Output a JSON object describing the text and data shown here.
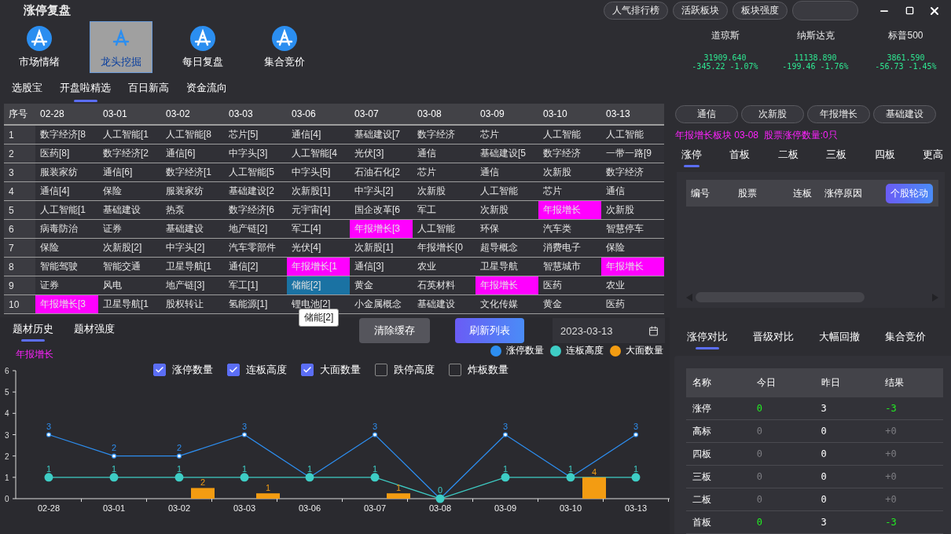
{
  "title": "涨停复盘",
  "top_buttons": [
    "人气排行榜",
    "活跃板块",
    "板块强度"
  ],
  "nav": [
    {
      "label": "市场情绪",
      "selected": false
    },
    {
      "label": "龙头挖掘",
      "selected": true
    },
    {
      "label": "每日复盘",
      "selected": false
    },
    {
      "label": "集合竞价",
      "selected": false
    }
  ],
  "indices": [
    {
      "name": "道琼斯",
      "value": "31909.640",
      "change": "-345.22",
      "percent": "-1.07%"
    },
    {
      "name": "纳斯达克",
      "value": "11138.890",
      "change": "-199.46",
      "percent": "-1.76%"
    },
    {
      "name": "标普500",
      "value": "3861.590",
      "change": "-56.73",
      "percent": "-1.45%"
    }
  ],
  "sub_tabs": [
    {
      "label": "选股宝",
      "selected": false
    },
    {
      "label": "开盘啦精选",
      "selected": true
    },
    {
      "label": "百日新高",
      "selected": false
    },
    {
      "label": "资金流向",
      "selected": false
    }
  ],
  "table": {
    "columns": [
      "序号",
      "02-28",
      "03-01",
      "03-02",
      "03-03",
      "03-06",
      "03-07",
      "03-08",
      "03-09",
      "03-10",
      "03-13"
    ],
    "rows": [
      {
        "cells": [
          "1",
          "数字经济[8",
          "人工智能[1",
          "人工智能[8",
          "芯片[5]",
          "通信[4]",
          "基础建设[7",
          "数字经济",
          "芯片",
          "人工智能",
          "人工智能"
        ]
      },
      {
        "cells": [
          "2",
          "医药[8]",
          "数字经济[2",
          "通信[6]",
          "中字头[3]",
          "人工智能[4",
          "光伏[3]",
          "通信",
          "基础建设[5",
          "数字经济",
          "一带一路[9"
        ]
      },
      {
        "cells": [
          "3",
          "服装家纺",
          "通信[6]",
          "数字经济[1",
          "人工智能[5",
          "中字头[5]",
          "石油石化[2",
          "芯片",
          "通信",
          "次新股",
          "数字经济"
        ]
      },
      {
        "cells": [
          "4",
          "通信[4]",
          "保险",
          "服装家纺",
          "基础建设[2",
          "次新股[1]",
          "中字头[2]",
          "次新股",
          "人工智能",
          "芯片",
          "通信"
        ]
      },
      {
        "cells": [
          "5",
          "人工智能[1",
          "基础建设",
          "热泵",
          "数字经济[6",
          "元宇宙[4]",
          "国企改革[6",
          "军工",
          "次新股",
          {
            "text": "年报增长",
            "color": "#ff00ff"
          },
          "次新股"
        ]
      },
      {
        "cells": [
          "6",
          "病毒防治",
          "证券",
          "基础建设",
          "地产链[2]",
          "军工[4]",
          {
            "text": "年报增长[3",
            "color": "#ff00ff"
          },
          "人工智能",
          "环保",
          "汽车类",
          "智慧停车"
        ]
      },
      {
        "cells": [
          "7",
          "保险",
          "次新股[2]",
          "中字头[2]",
          "汽车零部件",
          "光伏[4]",
          "次新股[1]",
          "年报增长[0",
          "超导概念",
          "消费电子",
          "保险"
        ]
      },
      {
        "cells": [
          "8",
          "智能驾驶",
          "智能交通",
          "卫星导航[1",
          "通信[2]",
          {
            "text": "年报增长[1",
            "color": "#ff00ff"
          },
          "通信[3]",
          "农业",
          "卫星导航",
          "智慧城市",
          {
            "text": "年报增长",
            "color": "#ff00ff"
          }
        ]
      },
      {
        "cells": [
          "9",
          "证券",
          "风电",
          "地产链[3]",
          "军工[1]",
          {
            "text": "储能[2]",
            "color": "#1a72a3"
          },
          "黄金",
          "石英材料",
          {
            "text": "年报增长",
            "color": "#ff00ff"
          },
          "医药",
          "农业"
        ]
      },
      {
        "cells": [
          "10",
          {
            "text": "年报增长[3",
            "color": "#ff00ff"
          },
          "卫星导航[1",
          "股权转让",
          "氢能源[1]",
          "锂电池[2]",
          "小金属概念",
          "基础建设",
          "文化传媒",
          "黄金",
          "医药"
        ]
      }
    ]
  },
  "tooltip": "储能[2]",
  "sector_buttons": [
    "通信",
    "次新股",
    "年报增长",
    "基础建设"
  ],
  "sector_info": "年报增长板块 03-08  股票涨停数量:0只",
  "board_tabs": [
    {
      "label": "涨停",
      "selected": true
    },
    {
      "label": "首板",
      "selected": false
    },
    {
      "label": "二板",
      "selected": false
    },
    {
      "label": "三板",
      "selected": false
    },
    {
      "label": "四板",
      "selected": false
    },
    {
      "label": "更高",
      "selected": false
    }
  ],
  "stock_table": {
    "columns": [
      "编号",
      "股票",
      "连板",
      "涨停原因"
    ],
    "action": "个股轮动"
  },
  "history_tabs": [
    {
      "label": "题材历史",
      "selected": true
    },
    {
      "label": "题材强度",
      "selected": false
    }
  ],
  "clear_button": "清除缓存",
  "refresh_button": "刷新列表",
  "date": "2023-03-13",
  "chart_label": "年报增长",
  "toggles": [
    {
      "label": "涨停数量",
      "checked": true
    },
    {
      "label": "连板高度",
      "checked": true
    },
    {
      "label": "大面数量",
      "checked": true
    },
    {
      "label": "跌停高度",
      "checked": false
    },
    {
      "label": "炸板数量",
      "checked": false
    }
  ],
  "chart_data": {
    "type": "line",
    "categories": [
      "02-28",
      "03-01",
      "03-02",
      "03-03",
      "03-06",
      "03-07",
      "03-08",
      "03-09",
      "03-10",
      "03-13"
    ],
    "ylim": [
      0,
      6
    ],
    "yticks": [
      0,
      1,
      2,
      3,
      4,
      5,
      6
    ],
    "annotations": [
      "2",
      "1",
      "1",
      "4"
    ],
    "series": [
      {
        "name": "涨停数量",
        "type": "line",
        "marker": "dot",
        "color": "#2d8ef0",
        "values": [
          3,
          2,
          2,
          3,
          1,
          3,
          0,
          3,
          1,
          3
        ],
        "value_labels": [
          "3",
          "2",
          "2",
          "3",
          null,
          "3",
          null,
          "3",
          null,
          "3"
        ]
      },
      {
        "name": "连板高度",
        "type": "line",
        "marker": "circle",
        "color": "#3ecdc5",
        "values": [
          1,
          1,
          1,
          1,
          1,
          1,
          0,
          1,
          1,
          1
        ],
        "value_labels": [
          "1",
          "1",
          "1",
          "1",
          "1",
          "1",
          "0",
          "1",
          "1",
          "1"
        ]
      },
      {
        "name": "大面数量",
        "type": "bar",
        "color": "#f39c12",
        "values": [
          null,
          null,
          0.5,
          0.25,
          null,
          0.25,
          null,
          null,
          1,
          null
        ]
      }
    ]
  },
  "compare_tabs": [
    {
      "label": "涨停对比",
      "selected": true
    },
    {
      "label": "晋级对比",
      "selected": false
    },
    {
      "label": "大幅回撤",
      "selected": false
    },
    {
      "label": "集合竞价",
      "selected": false
    }
  ],
  "compare_table": {
    "columns": [
      "名称",
      "今日",
      "昨日",
      "结果"
    ],
    "rows": [
      {
        "name": "涨停",
        "today": "0",
        "yesterday": "3",
        "result": "-3",
        "active": true
      },
      {
        "name": "高标",
        "today": "0",
        "yesterday": "0",
        "result": "+0",
        "active": false
      },
      {
        "name": "四板",
        "today": "0",
        "yesterday": "0",
        "result": "+0",
        "active": false
      },
      {
        "name": "三板",
        "today": "0",
        "yesterday": "0",
        "result": "+0",
        "active": false
      },
      {
        "name": "二板",
        "today": "0",
        "yesterday": "0",
        "result": "+0",
        "active": false
      },
      {
        "name": "首板",
        "today": "0",
        "yesterday": "3",
        "result": "-3",
        "active": true
      }
    ]
  }
}
